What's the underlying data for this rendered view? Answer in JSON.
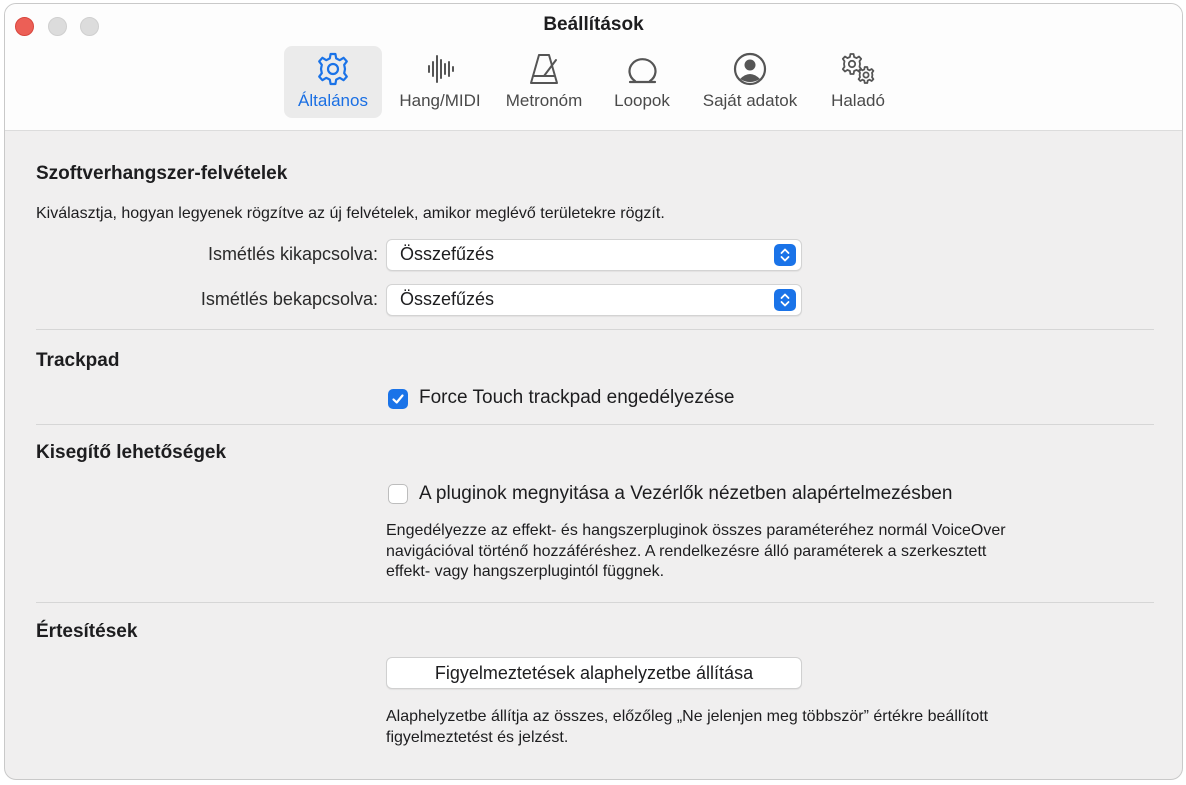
{
  "window": {
    "title": "Beállítások"
  },
  "toolbar": {
    "tabs": [
      {
        "label": "Általános",
        "icon": "gear-icon",
        "selected": true
      },
      {
        "label": "Hang/MIDI",
        "icon": "waveform-icon",
        "selected": false
      },
      {
        "label": "Metronóm",
        "icon": "metronome-icon",
        "selected": false
      },
      {
        "label": "Loopok",
        "icon": "loop-icon",
        "selected": false
      },
      {
        "label": "Saját adatok",
        "icon": "person-icon",
        "selected": false
      },
      {
        "label": "Haladó",
        "icon": "gears-icon",
        "selected": false
      }
    ]
  },
  "software_instrument": {
    "title": "Szoftverhangszer-felvételek",
    "description": "Kiválasztja, hogyan legyenek rögzítve az új felvételek, amikor meglévő területekre rögzít.",
    "cycle_off": {
      "label": "Ismétlés kikapcsolva:",
      "value": "Összefűzés"
    },
    "cycle_on": {
      "label": "Ismétlés bekapcsolva:",
      "value": "Összefűzés"
    }
  },
  "trackpad": {
    "title": "Trackpad",
    "force_touch": {
      "label": "Force Touch trackpad engedélyezése",
      "checked": true
    }
  },
  "accessibility": {
    "title": "Kisegítő lehetőségek",
    "open_plugins": {
      "label": "A pluginok megnyitása a Vezérlők nézetben alapértelmezésben",
      "checked": false
    },
    "note_lines": [
      "Engedélyezze az effekt- és hangszerpluginok összes paraméteréhez normál VoiceOver",
      "navigációval történő hozzáféréshez. A rendelkezésre álló paraméterek a szerkesztett",
      "effekt- vagy hangszerplugintól függnek."
    ]
  },
  "notifications": {
    "title": "Értesítések",
    "reset_button": "Figyelmeztetések alaphelyzetbe állítása",
    "note_lines": [
      "Alaphelyzetbe állítja az összes, előzőleg „Ne jelenjen meg többször” értékre beállított",
      "figyelmeztetést és jelzést."
    ]
  },
  "colors": {
    "accent": "#1a73e8",
    "close": "#ec5f56",
    "background": "#f0efef"
  }
}
